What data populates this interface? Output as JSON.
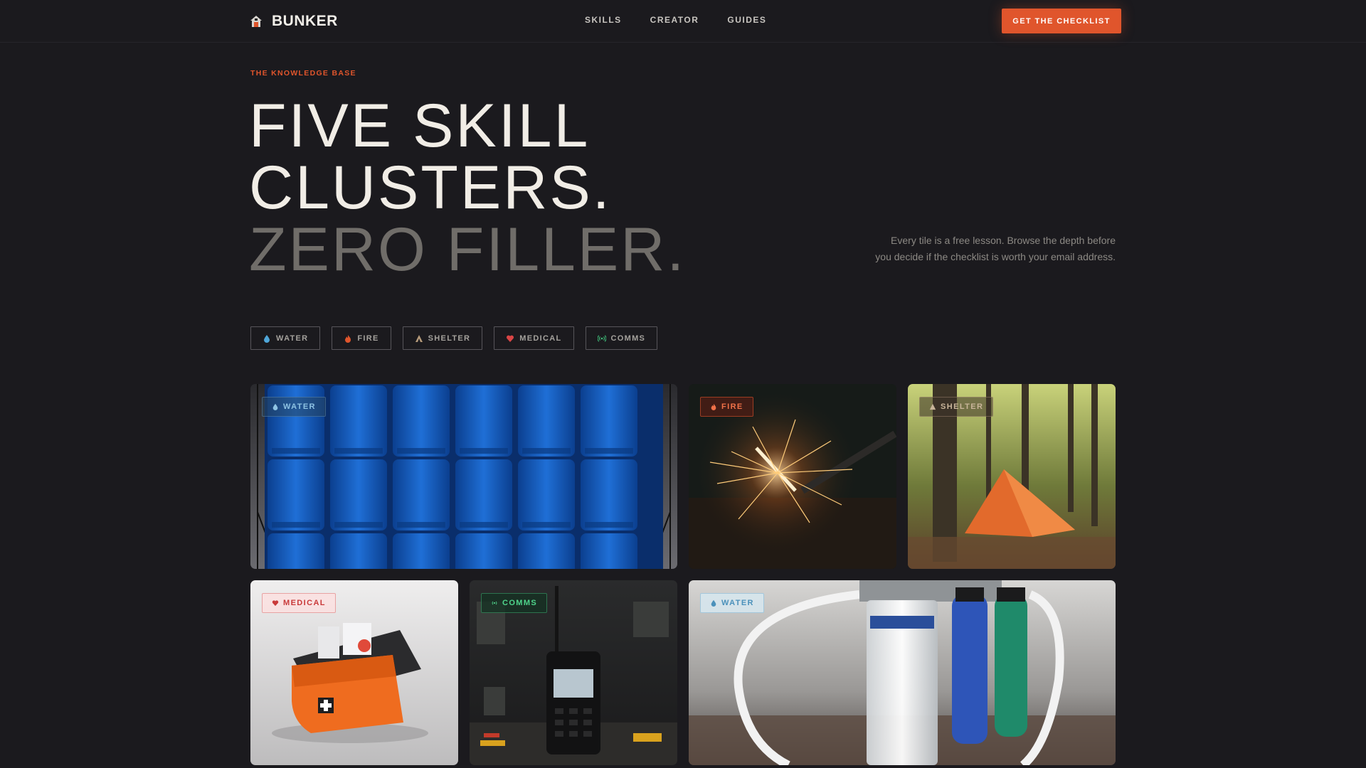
{
  "nav": {
    "brand": "BUNKER",
    "brand_icon": "bunker-house-icon",
    "links": [
      "SKILLS",
      "CREATOR",
      "GUIDES"
    ],
    "cta": "GET THE CHECKLIST"
  },
  "hero": {
    "eyebrow": "THE KNOWLEDGE BASE",
    "headline_line1": "FIVE SKILL",
    "headline_line2": "CLUSTERS.",
    "headline_line3": "ZERO FILLER.",
    "description": "Every tile is a free lesson. Browse the depth before you decide if the checklist is worth your email address."
  },
  "filters": [
    {
      "label": "WATER",
      "icon": "water-drop-icon",
      "color": "#4fa6d8"
    },
    {
      "label": "FIRE",
      "icon": "flame-icon",
      "color": "#e0552c"
    },
    {
      "label": "SHELTER",
      "icon": "tent-icon",
      "color": "#b59a7a"
    },
    {
      "label": "MEDICAL",
      "icon": "heart-icon",
      "color": "#d94545"
    },
    {
      "label": "COMMS",
      "icon": "signal-icon",
      "color": "#3fbf7a"
    }
  ],
  "tiles": [
    {
      "tag": "WATER",
      "image": "blue water jerrycans stacked"
    },
    {
      "tag": "FIRE",
      "image": "ferro rod sparks"
    },
    {
      "tag": "SHELTER",
      "image": "orange tarp shelter in forest"
    },
    {
      "tag": "MEDICAL",
      "image": "orange first aid kit"
    },
    {
      "tag": "COMMS",
      "image": "handheld two-way radio"
    },
    {
      "tag": "WATER",
      "image": "water filter cartridges"
    }
  ],
  "colors": {
    "background": "#1b1a1e",
    "accent": "#e0552c",
    "text": "#ece8e1",
    "muted": "#8c8984"
  }
}
